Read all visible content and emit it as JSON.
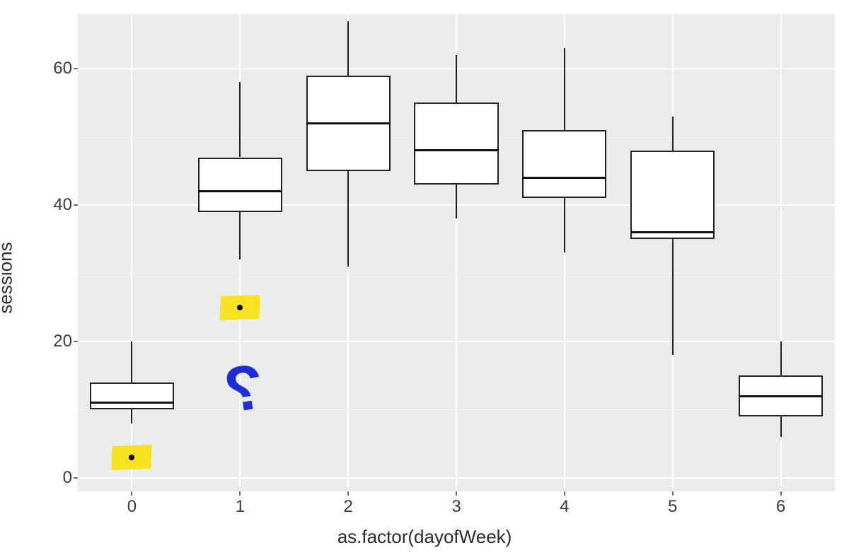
{
  "chart_data": {
    "type": "boxplot",
    "xlabel": "as.factor(dayofWeek)",
    "ylabel": "sessions",
    "ylim": [
      -2,
      68
    ],
    "y_ticks": [
      0,
      20,
      40,
      60
    ],
    "categories": [
      "0",
      "1",
      "2",
      "3",
      "4",
      "5",
      "6"
    ],
    "series": [
      {
        "category": "0",
        "min": 8,
        "q1": 10,
        "median": 11,
        "q3": 14,
        "max": 20,
        "outliers": [
          3
        ]
      },
      {
        "category": "1",
        "min": 32,
        "q1": 39,
        "median": 42,
        "q3": 47,
        "max": 58,
        "outliers": [
          25
        ]
      },
      {
        "category": "2",
        "min": 31,
        "q1": 45,
        "median": 52,
        "q3": 59,
        "max": 67,
        "outliers": []
      },
      {
        "category": "3",
        "min": 38,
        "q1": 43,
        "median": 48,
        "q3": 55,
        "max": 62,
        "outliers": []
      },
      {
        "category": "4",
        "min": 33,
        "q1": 41,
        "median": 44,
        "q3": 51,
        "max": 63,
        "outliers": []
      },
      {
        "category": "5",
        "min": 18,
        "q1": 35,
        "median": 36,
        "q3": 48,
        "max": 53,
        "outliers": []
      },
      {
        "category": "6",
        "min": 6,
        "q1": 9,
        "median": 12,
        "q3": 15,
        "max": 20,
        "outliers": []
      }
    ],
    "annotations": {
      "highlighted_outliers": [
        {
          "category": "0",
          "value": 3
        },
        {
          "category": "1",
          "value": 25
        }
      ],
      "question_mark": {
        "near_category": "1",
        "approx_y": 13,
        "color": "#1c2fd6"
      }
    }
  }
}
